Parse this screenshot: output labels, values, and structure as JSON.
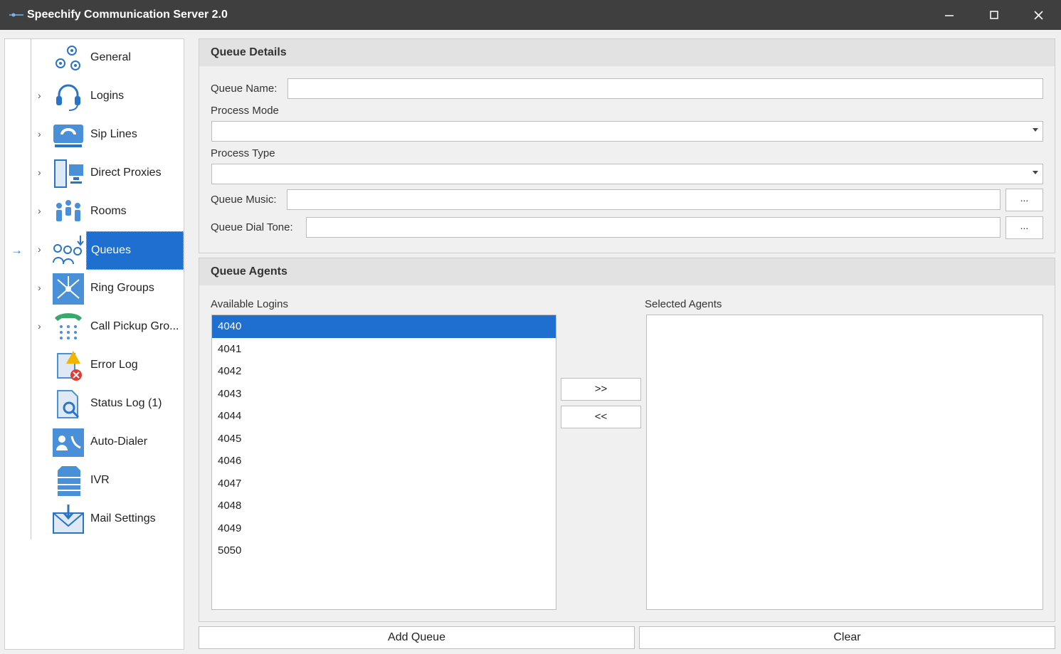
{
  "window": {
    "title": "Speechify Communication Server 2.0",
    "minimize_icon": "minimize-icon",
    "maximize_icon": "maximize-icon",
    "close_icon": "close-icon"
  },
  "nav": {
    "items": [
      {
        "label": "General",
        "icon": "gears-icon",
        "expandable": false
      },
      {
        "label": "Logins",
        "icon": "headset-icon",
        "expandable": true
      },
      {
        "label": "Sip Lines",
        "icon": "phone-router-icon",
        "expandable": true
      },
      {
        "label": "Direct Proxies",
        "icon": "computers-icon",
        "expandable": true
      },
      {
        "label": "Rooms",
        "icon": "meeting-room-icon",
        "expandable": true
      },
      {
        "label": "Queues",
        "icon": "people-queue-icon",
        "expandable": true,
        "selected": true
      },
      {
        "label": "Ring Groups",
        "icon": "network-icon",
        "expandable": true
      },
      {
        "label": "Call Pickup Gro...",
        "icon": "phone-keypad-icon",
        "expandable": true
      },
      {
        "label": "Error Log",
        "icon": "error-log-icon",
        "expandable": false
      },
      {
        "label": "Status Log (1)",
        "icon": "status-log-icon",
        "expandable": false
      },
      {
        "label": "Auto-Dialer",
        "icon": "auto-dialer-icon",
        "expandable": false
      },
      {
        "label": "IVR",
        "icon": "server-icon",
        "expandable": false
      },
      {
        "label": "Mail Settings",
        "icon": "mail-icon",
        "expandable": false
      }
    ]
  },
  "queue_details": {
    "header": "Queue Details",
    "queue_name_label": "Queue Name:",
    "queue_name_value": "",
    "process_mode_label": "Process Mode",
    "process_mode_value": "",
    "process_type_label": "Process Type",
    "process_type_value": "",
    "queue_music_label": "Queue Music:",
    "queue_music_value": "",
    "queue_dial_tone_label": "Queue Dial Tone:",
    "queue_dial_tone_value": "",
    "browse_label": "..."
  },
  "queue_agents": {
    "header": "Queue Agents",
    "available_label": "Available Logins",
    "selected_label": "Selected Agents",
    "available_logins": [
      "4040",
      "4041",
      "4042",
      "4043",
      "4044",
      "4045",
      "4046",
      "4047",
      "4048",
      "4049",
      "5050"
    ],
    "selected_index": 0,
    "selected_agents": [],
    "add_label": ">>",
    "remove_label": "<<"
  },
  "actions": {
    "add_queue": "Add Queue",
    "clear": "Clear"
  },
  "colors": {
    "accent": "#1f6fd0",
    "titlebar": "#3f3f3f",
    "panel_header": "#e2e2e2"
  }
}
